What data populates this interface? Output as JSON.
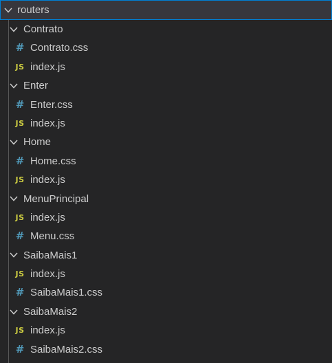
{
  "explorer": {
    "root": {
      "label": "routers",
      "expanded": true
    },
    "folders": [
      {
        "label": "Contrato",
        "files": [
          {
            "name": "Contrato.css",
            "type": "css"
          },
          {
            "name": "index.js",
            "type": "js"
          }
        ]
      },
      {
        "label": "Enter",
        "files": [
          {
            "name": "Enter.css",
            "type": "css"
          },
          {
            "name": "index.js",
            "type": "js"
          }
        ]
      },
      {
        "label": "Home",
        "files": [
          {
            "name": "Home.css",
            "type": "css"
          },
          {
            "name": "index.js",
            "type": "js"
          }
        ]
      },
      {
        "label": "MenuPrincipal",
        "files": [
          {
            "name": "index.js",
            "type": "js"
          },
          {
            "name": "Menu.css",
            "type": "css"
          }
        ]
      },
      {
        "label": "SaibaMais1",
        "files": [
          {
            "name": "index.js",
            "type": "js"
          },
          {
            "name": "SaibaMais1.css",
            "type": "css"
          }
        ]
      },
      {
        "label": "SaibaMais2",
        "files": [
          {
            "name": "index.js",
            "type": "js"
          },
          {
            "name": "SaibaMais2.css",
            "type": "css"
          }
        ]
      }
    ],
    "icons": {
      "css": "#",
      "js": "JS"
    },
    "colors": {
      "background": "#252526",
      "selected_row": "#37373d",
      "focus_border": "#007fd4",
      "text": "#cccccc",
      "css_icon": "#519aba",
      "js_icon": "#cbcb41"
    }
  }
}
